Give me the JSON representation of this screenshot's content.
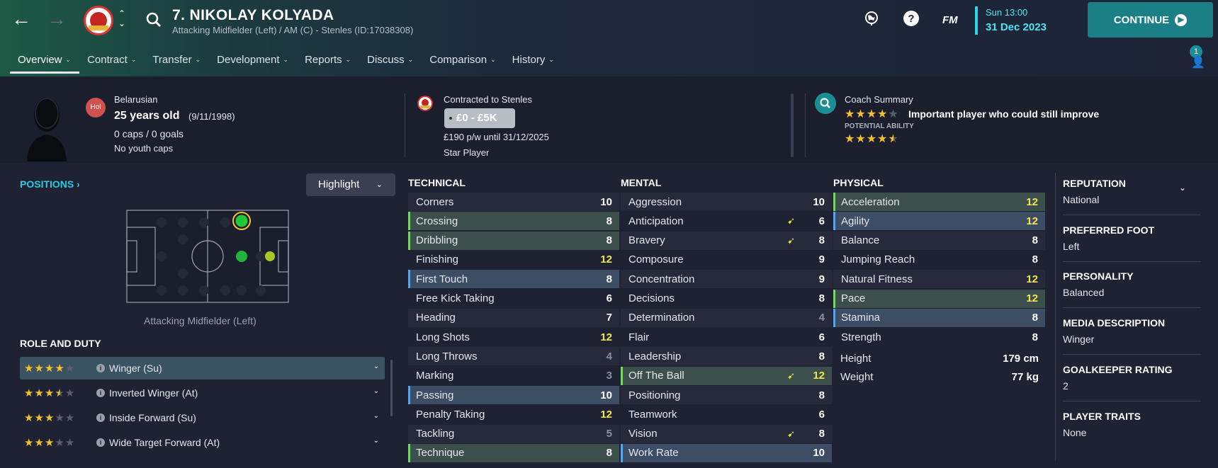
{
  "header": {
    "title": "7. NIKOLAY KOLYADA",
    "subtitle": "Attacking Midfielder (Left) / AM (C) - Stenles (ID:17038308)",
    "fm_label": "FM",
    "time": "Sun 13:00",
    "date": "31 Dec 2023",
    "continue_label": "CONTINUE",
    "notification_count": "1"
  },
  "tabs": [
    "Overview",
    "Contract",
    "Transfer",
    "Development",
    "Reports",
    "Discuss",
    "Comparison",
    "History"
  ],
  "player": {
    "nationality_badge": "Hol",
    "nationality": "Belarusian",
    "age": "25 years old",
    "dob": "(9/11/1998)",
    "caps": "0 caps / 0 goals",
    "youth": "No youth caps"
  },
  "contract": {
    "club_line": "Contracted to Stenles",
    "value_range": "£0 - £5K",
    "wage_line": "£190 p/w until 31/12/2025",
    "status": "Star Player"
  },
  "coach": {
    "title": "Coach Summary",
    "current_stars": 4,
    "summary": "Important player who could still improve",
    "potential_label": "POTENTIAL ABILITY",
    "potential_stars": 4.5
  },
  "positions": {
    "heading": "POSITIONS",
    "highlight_label": "Highlight",
    "caption": "Attacking Midfielder (Left)"
  },
  "roles": {
    "heading": "ROLE AND DUTY",
    "items": [
      {
        "name": "Winger (Su)",
        "stars": 4,
        "selected": true
      },
      {
        "name": "Inverted Winger (At)",
        "stars": 3.5,
        "selected": false
      },
      {
        "name": "Inside Forward (Su)",
        "stars": 3,
        "selected": false
      },
      {
        "name": "Wide Target Forward (At)",
        "stars": 3,
        "selected": false
      }
    ]
  },
  "technical": {
    "heading": "TECHNICAL",
    "rows": [
      {
        "name": "Corners",
        "value": "10",
        "hl": "",
        "color": "white"
      },
      {
        "name": "Crossing",
        "value": "8",
        "hl": "green",
        "color": "white"
      },
      {
        "name": "Dribbling",
        "value": "8",
        "hl": "green",
        "color": "white"
      },
      {
        "name": "Finishing",
        "value": "12",
        "hl": "",
        "color": "yellow"
      },
      {
        "name": "First Touch",
        "value": "8",
        "hl": "blue",
        "color": "white"
      },
      {
        "name": "Free Kick Taking",
        "value": "6",
        "hl": "",
        "color": "white"
      },
      {
        "name": "Heading",
        "value": "7",
        "hl": "",
        "color": "white"
      },
      {
        "name": "Long Shots",
        "value": "12",
        "hl": "",
        "color": "yellow"
      },
      {
        "name": "Long Throws",
        "value": "4",
        "hl": "",
        "color": "grey"
      },
      {
        "name": "Marking",
        "value": "3",
        "hl": "",
        "color": "grey"
      },
      {
        "name": "Passing",
        "value": "10",
        "hl": "blue",
        "color": "white"
      },
      {
        "name": "Penalty Taking",
        "value": "12",
        "hl": "",
        "color": "yellow"
      },
      {
        "name": "Tackling",
        "value": "5",
        "hl": "",
        "color": "grey"
      },
      {
        "name": "Technique",
        "value": "8",
        "hl": "green",
        "color": "white"
      }
    ]
  },
  "mental": {
    "heading": "MENTAL",
    "rows": [
      {
        "name": "Aggression",
        "value": "10",
        "hl": "",
        "color": "white",
        "arrow": false
      },
      {
        "name": "Anticipation",
        "value": "6",
        "hl": "",
        "color": "white",
        "arrow": true
      },
      {
        "name": "Bravery",
        "value": "8",
        "hl": "",
        "color": "white",
        "arrow": true
      },
      {
        "name": "Composure",
        "value": "9",
        "hl": "",
        "color": "white",
        "arrow": false
      },
      {
        "name": "Concentration",
        "value": "9",
        "hl": "",
        "color": "white",
        "arrow": false
      },
      {
        "name": "Decisions",
        "value": "8",
        "hl": "",
        "color": "white",
        "arrow": false
      },
      {
        "name": "Determination",
        "value": "4",
        "hl": "",
        "color": "grey",
        "arrow": false
      },
      {
        "name": "Flair",
        "value": "6",
        "hl": "",
        "color": "white",
        "arrow": false
      },
      {
        "name": "Leadership",
        "value": "8",
        "hl": "",
        "color": "white",
        "arrow": false
      },
      {
        "name": "Off The Ball",
        "value": "12",
        "hl": "green",
        "color": "yellow",
        "arrow": true
      },
      {
        "name": "Positioning",
        "value": "8",
        "hl": "",
        "color": "white",
        "arrow": false
      },
      {
        "name": "Teamwork",
        "value": "6",
        "hl": "",
        "color": "white",
        "arrow": false
      },
      {
        "name": "Vision",
        "value": "8",
        "hl": "",
        "color": "white",
        "arrow": true
      },
      {
        "name": "Work Rate",
        "value": "10",
        "hl": "blue",
        "color": "white",
        "arrow": false
      }
    ]
  },
  "physical": {
    "heading": "PHYSICAL",
    "rows": [
      {
        "name": "Acceleration",
        "value": "12",
        "hl": "green",
        "color": "yellow"
      },
      {
        "name": "Agility",
        "value": "12",
        "hl": "blue",
        "color": "yellow"
      },
      {
        "name": "Balance",
        "value": "8",
        "hl": "",
        "color": "white"
      },
      {
        "name": "Jumping Reach",
        "value": "8",
        "hl": "",
        "color": "white"
      },
      {
        "name": "Natural Fitness",
        "value": "12",
        "hl": "",
        "color": "yellow"
      },
      {
        "name": "Pace",
        "value": "12",
        "hl": "green",
        "color": "yellow"
      },
      {
        "name": "Stamina",
        "value": "8",
        "hl": "blue",
        "color": "white"
      },
      {
        "name": "Strength",
        "value": "8",
        "hl": "",
        "color": "white"
      }
    ],
    "height_label": "Height",
    "height_value": "179 cm",
    "weight_label": "Weight",
    "weight_value": "77 kg"
  },
  "sidebar": [
    {
      "label": "REPUTATION",
      "value": "National"
    },
    {
      "label": "PREFERRED FOOT",
      "value": "Left"
    },
    {
      "label": "PERSONALITY",
      "value": "Balanced"
    },
    {
      "label": "MEDIA DESCRIPTION",
      "value": "Winger"
    },
    {
      "label": "GOALKEEPER RATING",
      "value": "2"
    },
    {
      "label": "PLAYER TRAITS",
      "value": "None"
    }
  ],
  "colors": {
    "accent": "#2cc7e6",
    "continue": "#1b7f86",
    "star": "#f3c12d",
    "high_value": "#f2e84b"
  }
}
